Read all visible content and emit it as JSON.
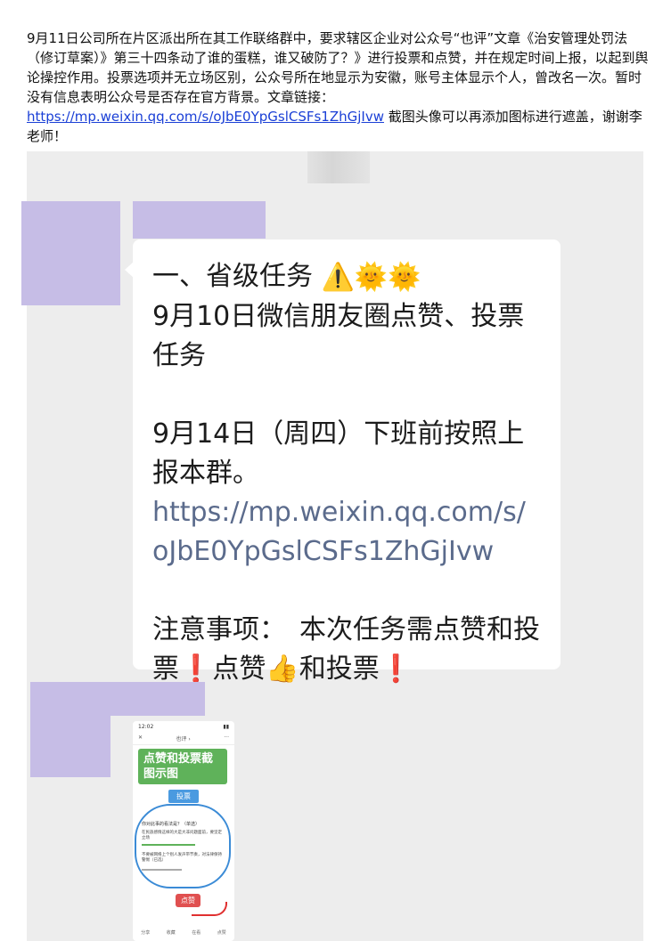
{
  "intro": {
    "text_before_link": "9月11日公司所在片区派出所在其工作联络群中，要求辖区企业对公众号“也评”文章《治安管理处罚法（修订草案）》第三十四条动了谁的蛋糕，谁又破防了？》进行投票和点赞，并在规定时间上报，以起到舆论操控作用。投票选项并无立场区别，公众号所在地显示为安徽，账号主体显示个人，曾改名一次。暂时没有信息表明公众号是否存在官方背景。文章链接：",
    "link": "https://mp.weixin.qq.com/s/oJbE0YpGslCSFs1ZhGjIvw",
    "text_after_link": "    截图头像可以再添加图标进行遮盖，谢谢李老师！"
  },
  "message": {
    "line1": "一、省级任务",
    "line1_emojis": "⚠️🌞🌞",
    "line2": "9月10日微信朋友圈点赞、投票任务",
    "line3": "9月14日（周四）下班前按照上报本群。",
    "link": "https://mp.weixin.qq.com/s/oJbE0YpGslCSFs1ZhGjIvw",
    "note_prefix": "注意事项：　本次任务需点赞和投票",
    "note_mark1": "❗",
    "note_mid": "点赞",
    "note_thumb": "👍",
    "note_end": "和投票",
    "note_mark2": "❗"
  },
  "screenshot_thumb": {
    "time": "12:02",
    "nav_title": "也评 ›",
    "banner": "点赞和投票截图示图",
    "vote_label": "投票",
    "question": "你对此事的看法是？（单选）",
    "option1": "在民族感情这样的大是大非问题面前，要坚定立场",
    "option2": "不要被网络上个别人发声带节奏，对法律保持警惕（已选）",
    "like_label": "点赞",
    "bottom_items": [
      "分享",
      "收藏",
      "在看",
      "点赞"
    ]
  }
}
